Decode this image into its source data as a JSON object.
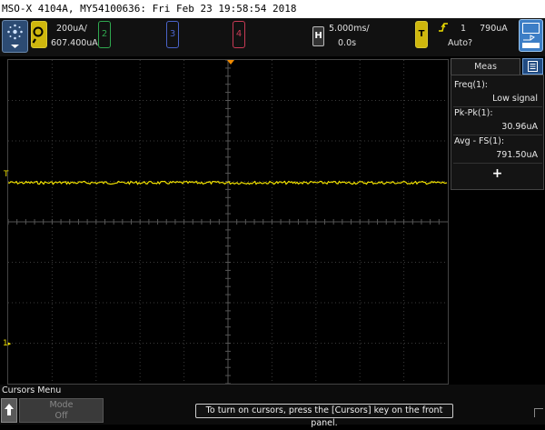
{
  "title": "MSO-X 4104A, MY54100636: Fri Feb 23 19:58:54 2018",
  "channel1": {
    "scale": "200uA/",
    "offset": "607.400uA",
    "color": "#f0e000"
  },
  "channels": [
    {
      "label": "2",
      "color": "#2fa84f"
    },
    {
      "label": "3",
      "color": "#4a63c8"
    },
    {
      "label": "4",
      "color": "#c83a55"
    }
  ],
  "horizontal": {
    "button": "H",
    "timebase": "5.000ms/",
    "delay": "0.0s"
  },
  "trigger": {
    "button": "T",
    "source": "1",
    "level": "790uA",
    "mode": "Auto?",
    "slope_icon": "rising-edge-icon"
  },
  "measurements": {
    "tab_label": "Meas",
    "items": [
      {
        "name": "Freq(1):",
        "value": "Low signal"
      },
      {
        "name": "Pk-Pk(1):",
        "value": "30.96uA"
      },
      {
        "name": "Avg - FS(1):",
        "value": "791.50uA"
      }
    ],
    "add_label": "+"
  },
  "waveform": {
    "trigger_marker": "T",
    "ground_marker": "1"
  },
  "softkeys": {
    "menu_title": "Cursors Menu",
    "mode_label": "Mode",
    "mode_value": "Off"
  },
  "hint": "To turn on cursors, press the [Cursors] key on the front panel."
}
